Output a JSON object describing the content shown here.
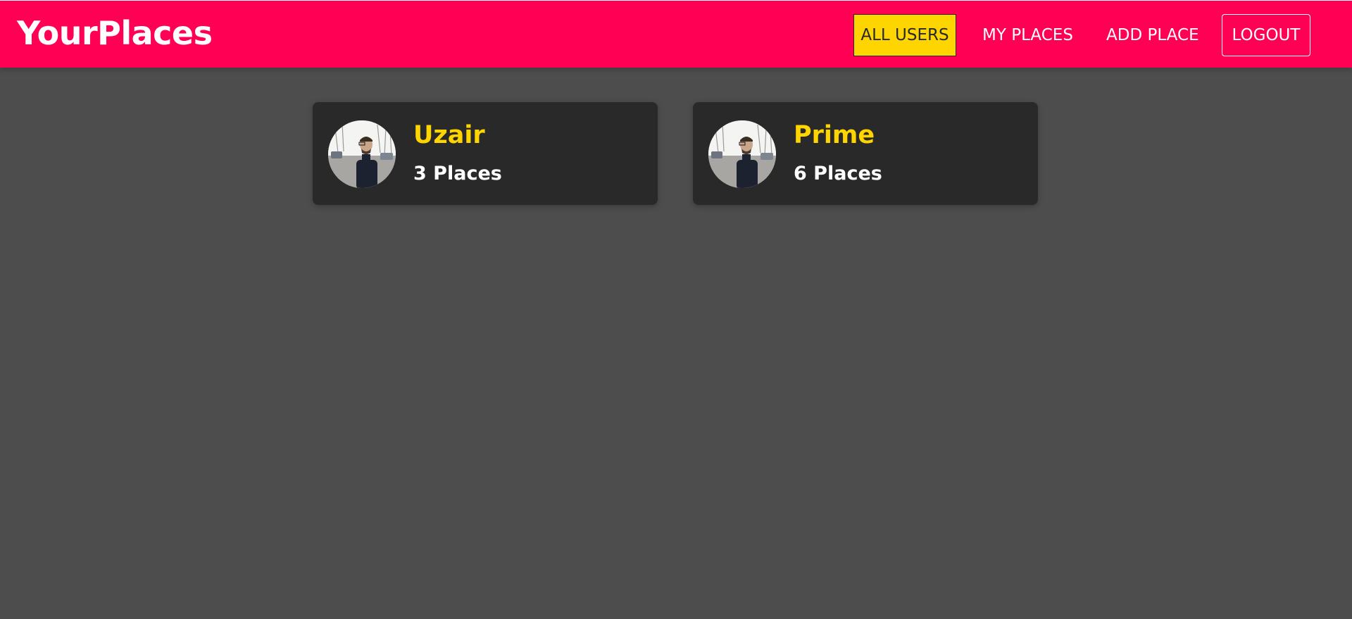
{
  "app": {
    "brand": "YourPlaces"
  },
  "nav": {
    "items": [
      {
        "label": "ALL USERS",
        "active": true
      },
      {
        "label": "MY PLACES",
        "active": false
      },
      {
        "label": "ADD PLACE",
        "active": false
      }
    ],
    "logout_label": "LOGOUT"
  },
  "users": [
    {
      "name": "Uzair",
      "places": "3 Places"
    },
    {
      "name": "Prime",
      "places": "6 Places"
    }
  ],
  "colors": {
    "header": "#ff0055",
    "background": "#4d4d4d",
    "card": "#292929",
    "accent": "#ffd500",
    "text": "#ffffff"
  },
  "icons": {
    "avatar": "user-avatar-photo"
  }
}
